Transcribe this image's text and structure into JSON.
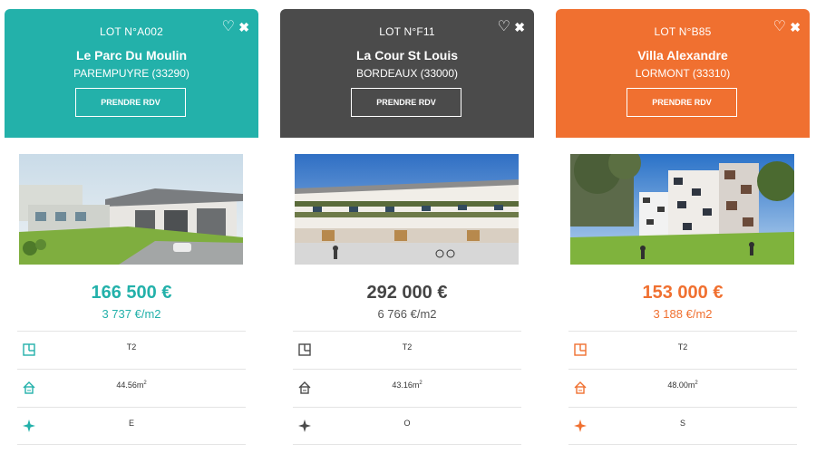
{
  "cards": [
    {
      "lot": "LOT N°A002",
      "name": "Le Parc Du Moulin",
      "city": "PAREMPUYRE (33290)",
      "cta": "PRENDRE RDV",
      "price": "166 500 €",
      "price_per_m2": "3 737 €/m2",
      "typology": "T2",
      "surface": "44.56m",
      "surface_unit_exp": "2",
      "orientation": "E",
      "accent_color": "#23b1aa"
    },
    {
      "lot": "LOT N°F11",
      "name": "La Cour St Louis",
      "city": "BORDEAUX (33000)",
      "cta": "PRENDRE RDV",
      "price": "292 000 €",
      "price_per_m2": "6 766 €/m2",
      "typology": "T2",
      "surface": "43.16m",
      "surface_unit_exp": "2",
      "orientation": "O",
      "accent_color": "#4b4b4b"
    },
    {
      "lot": "LOT N°B85",
      "name": "Villa Alexandre",
      "city": "LORMONT (33310)",
      "cta": "PRENDRE RDV",
      "price": "153 000 €",
      "price_per_m2": "3 188 €/m2",
      "typology": "T2",
      "surface": "48.00m",
      "surface_unit_exp": "2",
      "orientation": "S",
      "accent_color": "#f07030"
    }
  ],
  "icons": {
    "favorite": "heart-outline-icon",
    "close": "close-icon",
    "typology": "floor-plan-icon",
    "surface": "house-icon",
    "orientation": "compass-star-icon"
  }
}
